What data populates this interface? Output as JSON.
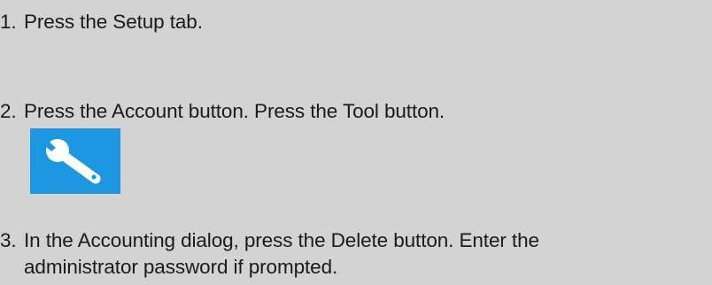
{
  "steps": [
    {
      "number": "1.",
      "text": "Press the Setup tab."
    },
    {
      "number": "2.",
      "text": "Press the Account button. Press the Tool button.",
      "icon": "wrench-icon",
      "icon_background": "#1d97df",
      "icon_color": "#ffffff"
    },
    {
      "number": "3.",
      "text": "In the Accounting dialog, press the Delete button. Enter the",
      "text_continued": "administrator password if prompted."
    }
  ]
}
